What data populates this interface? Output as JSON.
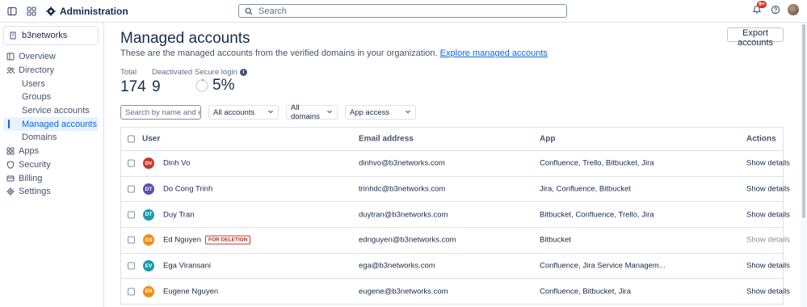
{
  "topbar": {
    "app_title": "Administration",
    "search_placeholder": "Search",
    "notification_count": "9+"
  },
  "sidebar": {
    "site_name": "b3networks",
    "items": [
      {
        "label": "Overview",
        "icon": "overview-icon",
        "level": 0,
        "active": false
      },
      {
        "label": "Directory",
        "icon": "people-icon",
        "level": 0,
        "active": false
      },
      {
        "label": "Users",
        "level": 1,
        "active": false
      },
      {
        "label": "Groups",
        "level": 1,
        "active": false
      },
      {
        "label": "Service accounts",
        "level": 1,
        "active": false
      },
      {
        "label": "Managed accounts",
        "level": 1,
        "active": true
      },
      {
        "label": "Domains",
        "level": 1,
        "active": false
      },
      {
        "label": "Apps",
        "icon": "apps-icon",
        "level": 0,
        "active": false
      },
      {
        "label": "Security",
        "icon": "shield-icon",
        "level": 0,
        "active": false
      },
      {
        "label": "Billing",
        "icon": "billing-icon",
        "level": 0,
        "active": false
      },
      {
        "label": "Settings",
        "icon": "gear-icon",
        "level": 0,
        "active": false
      }
    ]
  },
  "main": {
    "title": "Managed accounts",
    "export_label": "Export accounts",
    "description": "These are the managed accounts from the verified domains in your organization.",
    "description_link": "Explore managed accounts",
    "stats": {
      "total_label": "Total",
      "total_value": "174",
      "deactivated_label": "Deactivated",
      "deactivated_value": "9",
      "secure_label": "Secure login",
      "secure_value": "5%",
      "secure_fraction": 0.05
    },
    "filters": {
      "search_placeholder": "Search by name and email",
      "accounts": "All accounts",
      "domains": "All domains",
      "app_access": "App access"
    },
    "table": {
      "headers": {
        "user": "User",
        "email": "Email address",
        "app": "App",
        "actions": "Actions"
      },
      "rows": [
        {
          "initials": "DV",
          "color": "#c9372c",
          "name": "Dinh Vo",
          "tag": "",
          "email": "dinhvo@b3networks.com",
          "apps": "Confluence, Trello, Bitbucket, Jira",
          "action": "Show details",
          "disabled": false
        },
        {
          "initials": "DT",
          "color": "#5e4db2",
          "name": "Do Cong Trinh",
          "tag": "",
          "email": "trinhdc@b3networks.com",
          "apps": "Jira, Confluence, Bitbucket",
          "action": "Show details",
          "disabled": false
        },
        {
          "initials": "DT",
          "color": "#1d9aaa",
          "name": "Duy Tran",
          "tag": "",
          "email": "duytran@b3networks.com",
          "apps": "Bitbucket, Confluence, Trello, Jira",
          "action": "Show details",
          "disabled": false
        },
        {
          "initials": "EN",
          "color": "#f18d13",
          "name": "Ed Nguyen",
          "tag": "FOR DELETION",
          "email": "ednguyen@b3networks.com",
          "apps": "Bitbucket",
          "action": "Show details",
          "disabled": true
        },
        {
          "initials": "EV",
          "color": "#1d9aaa",
          "name": "Ega Viransani",
          "tag": "",
          "email": "ega@b3networks.com",
          "apps": "Confluence, Jira Service Managem...",
          "action": "Show details",
          "disabled": false
        },
        {
          "initials": "EN",
          "color": "#f18d13",
          "name": "Eugene Nguyen",
          "tag": "",
          "email": "eugene@b3networks.com",
          "apps": "Confluence, Bitbucket, Jira",
          "action": "Show details",
          "disabled": false
        }
      ]
    }
  }
}
